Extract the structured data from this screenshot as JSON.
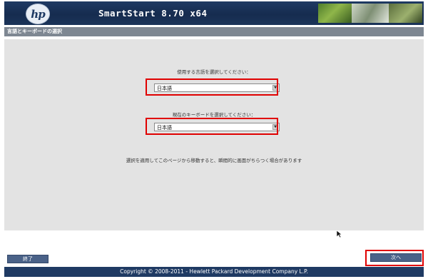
{
  "header": {
    "logo_text": "hp",
    "title": "SmartStart 8.70 x64"
  },
  "section": {
    "title": "言語とキーボードの選択"
  },
  "language": {
    "label": "使用する言語を選択してください：",
    "selected": "日本語"
  },
  "keyboard": {
    "label": "現在のキーボードを選択してください：",
    "selected": "日本語"
  },
  "notice": "選択を適用してこのページから移動すると、瞬間的に画面がちらつく場合があります",
  "buttons": {
    "exit": "終了",
    "next": "次へ"
  },
  "footer": {
    "copyright": "Copyright © 2008-2011 - Hewlett Packard Development Company L.P."
  },
  "colors": {
    "header": "#1f3a63",
    "highlight": "#e00000",
    "button": "#4a6288"
  }
}
